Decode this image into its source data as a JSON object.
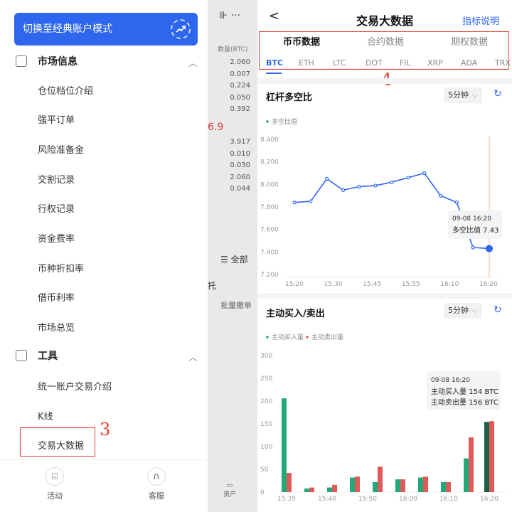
{
  "sidebar": {
    "switch_label": "切换至经典账户模式",
    "section_market": "市场信息",
    "market_items": [
      "仓位档位介绍",
      "强平订单",
      "风险准备金",
      "交割记录",
      "行权记录",
      "资金费率",
      "币种折扣率",
      "借币利率",
      "市场总览"
    ],
    "section_tools": "工具",
    "tool_items": [
      "统一账户交易介绍",
      "K线",
      "交易大数据"
    ],
    "bottom": [
      "活动",
      "客服"
    ]
  },
  "annotations": {
    "left_number": "3",
    "right_number": "4"
  },
  "middle": {
    "header": "数量(BTC)",
    "values_top": [
      "2.060",
      "0.007",
      "0.224",
      "0.050",
      "0.392"
    ],
    "price_red": "6.9",
    "values_bottom": [
      "3.917",
      "0.010",
      "0.030",
      "2.060",
      "0.044"
    ],
    "all_label": "全部",
    "tuo_label": "托",
    "batch_cancel": "批量撤单",
    "assets": "资产"
  },
  "header": {
    "title": "交易大数据",
    "link": "指标说明"
  },
  "tabs": [
    "币币数据",
    "合约数据",
    "期权数据"
  ],
  "coins": [
    "BTC",
    "ETH",
    "LTC",
    "DOT",
    "FIL",
    "XRP",
    "ADA",
    "TRX"
  ],
  "colors": {
    "accent": "#2e67ee",
    "buy": "#22a97a",
    "sell": "#e05a5a",
    "buy_dark": "#1b5f45",
    "annotation": "#e4442b"
  },
  "chart1": {
    "title": "杠杆多空比",
    "interval": "5分钟",
    "legend": "多空比值",
    "tooltip": {
      "time": "09-08 16:20",
      "label": "多空比值",
      "value": "7.43"
    }
  },
  "chart2": {
    "title": "主动买入/卖出",
    "interval": "5分钟",
    "legend": [
      "主动买入量",
      "主动卖出量"
    ],
    "tooltip": {
      "time": "09-08 16:20",
      "buy": "主动买入量 154 BTC",
      "sell": "主动卖出量 156 BTC"
    }
  },
  "chart_data": [
    {
      "type": "line",
      "series": [
        {
          "name": "多空比值",
          "values": [
            7.84,
            7.85,
            8.05,
            7.95,
            7.98,
            7.99,
            8.02,
            8.06,
            8.1,
            7.9,
            7.84,
            7.44,
            7.43
          ]
        }
      ],
      "x_ticks": [
        "15:20",
        "15:30",
        "15:45",
        "15:55",
        "16:10",
        "16:20"
      ],
      "y_ticks": [
        "8.400",
        "8.200",
        "8.000",
        "7.800",
        "7.600",
        "7.400",
        "7.200"
      ],
      "ylim": [
        7.2,
        8.4
      ],
      "grid": false
    },
    {
      "type": "bar",
      "series": [
        {
          "name": "主动买入量",
          "values": [
            206,
            8,
            10,
            32,
            22,
            28,
            32,
            22,
            74,
            154
          ]
        },
        {
          "name": "主动卖出量",
          "values": [
            42,
            10,
            16,
            34,
            56,
            28,
            34,
            22,
            120,
            156
          ]
        }
      ],
      "x_ticks": [
        "15:35",
        "15:40",
        "15:50",
        "16:00",
        "16:10",
        "16:20"
      ],
      "y_ticks": [
        "300",
        "250",
        "200",
        "150",
        "100",
        "50",
        "0"
      ],
      "ylim": [
        0,
        300
      ]
    }
  ]
}
